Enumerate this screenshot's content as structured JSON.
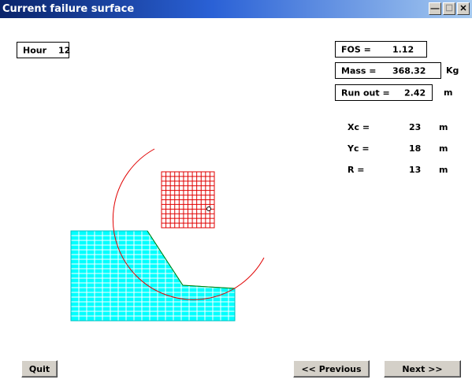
{
  "window": {
    "title": "Current failure surface",
    "minimize_icon": "minimize-icon",
    "maximize_icon": "maximize-icon",
    "close_icon": "close-icon"
  },
  "hour": {
    "label": "Hour",
    "value": "12"
  },
  "results": {
    "fos_label": "FOS =",
    "fos_value": "1.12",
    "mass_label": "Mass =",
    "mass_value": "368.32",
    "mass_unit": "Kg",
    "runout_label": "Run out =",
    "runout_value": "2.42",
    "runout_unit": "m"
  },
  "circle": {
    "xc_label": "Xc =",
    "xc_value": "23",
    "xc_unit": "m",
    "yc_label": "Yc =",
    "yc_value": "18",
    "yc_unit": "m",
    "r_label": "R =",
    "r_value": "13",
    "r_unit": "m"
  },
  "buttons": {
    "quit": "Quit",
    "previous": "<< Previous",
    "next": "Next >>"
  },
  "colors": {
    "slope": "#00ffff",
    "slope_outline": "#008000",
    "center_grid": "#e00000",
    "failure_arc": "#e00000"
  }
}
